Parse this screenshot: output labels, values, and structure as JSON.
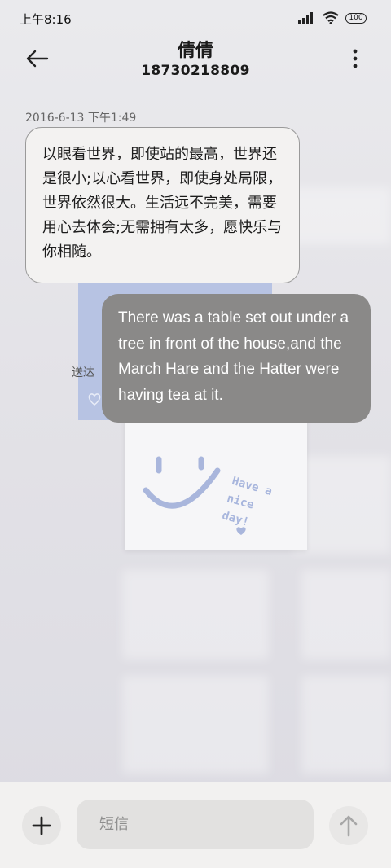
{
  "status_bar": {
    "time": "上午8:16",
    "battery": "100",
    "icons": [
      "signal-icon",
      "wifi-icon",
      "battery-icon"
    ]
  },
  "header": {
    "contact_name": "倩倩",
    "phone_number": "18730218809",
    "icons": [
      "back-arrow-icon",
      "more-vert-icon"
    ]
  },
  "conversation": {
    "timestamp": "2016-6-13 下午1:49",
    "incoming_message": "以眼看世界，即使站的最高，世界还是很小;以心看世界，即使身处局限，世界依然很大。生活远不完美，需要用心去体会;无需拥有太多，愿快乐与你相随。",
    "outgoing_message": "There was a table set out under a tree in front of the house,and the March Hare and the Hatter were having tea at it.",
    "delivery_status": "送达",
    "sticker_text": "Have a\nnice\nday!"
  },
  "composer": {
    "placeholder": "短信",
    "icons": [
      "plus-icon",
      "send-arrow-icon"
    ]
  },
  "colors": {
    "incoming_bubble": "#f3f2f1",
    "outgoing_bubble": "#8a8988",
    "sticker_blue": "#b7c3e3"
  }
}
